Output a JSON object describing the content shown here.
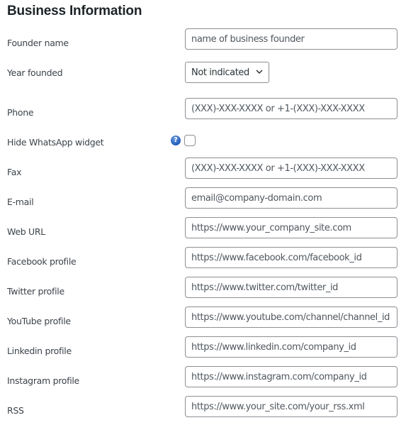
{
  "section_title": "Business Information",
  "fields": {
    "founder": {
      "label": "Founder name",
      "placeholder": "name of business founder"
    },
    "year": {
      "label": "Year founded",
      "selected": "Not indicated"
    },
    "phone": {
      "label": "Phone",
      "placeholder": "(XXX)-XXX-XXXX or +1-(XXX)-XXX-XXXX"
    },
    "whatsapp": {
      "label": "Hide WhatsApp widget",
      "help_icon": "?",
      "checked": false
    },
    "fax": {
      "label": "Fax",
      "placeholder": "(XXX)-XXX-XXXX or +1-(XXX)-XXX-XXXX"
    },
    "email": {
      "label": "E-mail",
      "placeholder": "email@company-domain.com"
    },
    "web": {
      "label": "Web URL",
      "placeholder": "https://www.your_company_site.com"
    },
    "facebook": {
      "label": "Facebook profile",
      "placeholder": "https://www.facebook.com/facebook_id"
    },
    "twitter": {
      "label": "Twitter profile",
      "placeholder": "https://www.twitter.com/twitter_id"
    },
    "youtube": {
      "label": "YouTube profile",
      "placeholder": "https://www.youtube.com/channel/channel_id"
    },
    "linkedin": {
      "label": "Linkedin profile",
      "placeholder": "https://www.linkedin.com/company_id"
    },
    "instagram": {
      "label": "Instagram profile",
      "placeholder": "https://www.instagram.com/company_id"
    },
    "rss": {
      "label": "RSS",
      "placeholder": "https://www.your_site.com/your_rss.xml"
    }
  }
}
